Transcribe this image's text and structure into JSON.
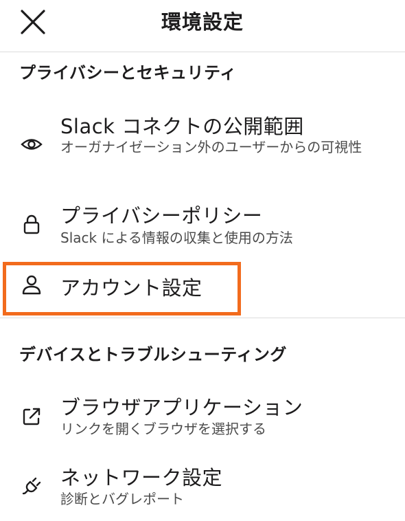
{
  "header": {
    "title": "環境設定",
    "close_icon": "close-icon"
  },
  "sections": {
    "privacy": {
      "title": "プライバシーとセキュリティ",
      "items": [
        {
          "label": "Slack コネクトの公開範囲",
          "description": "オーガナイゼーション外のユーザーからの可視性",
          "icon": "eye-icon"
        },
        {
          "label": "プライバシーポリシー",
          "description": "Slack による情報の収集と使用の方法",
          "icon": "lock-icon"
        },
        {
          "label": "アカウント設定",
          "icon": "person-icon"
        }
      ]
    },
    "devices": {
      "title": "デバイスとトラブルシューティング",
      "items": [
        {
          "label": "ブラウザアプリケーション",
          "description": "リンクを開くブラウザを選択する",
          "icon": "external-link-icon"
        },
        {
          "label": "ネットワーク設定",
          "description": "診断とバグレポート",
          "icon": "plug-icon"
        }
      ]
    }
  },
  "colors": {
    "highlight": "#f26b1d",
    "divider": "#dcdcdc",
    "text": "#1d1c1d",
    "subtext": "#4a4a4a"
  }
}
